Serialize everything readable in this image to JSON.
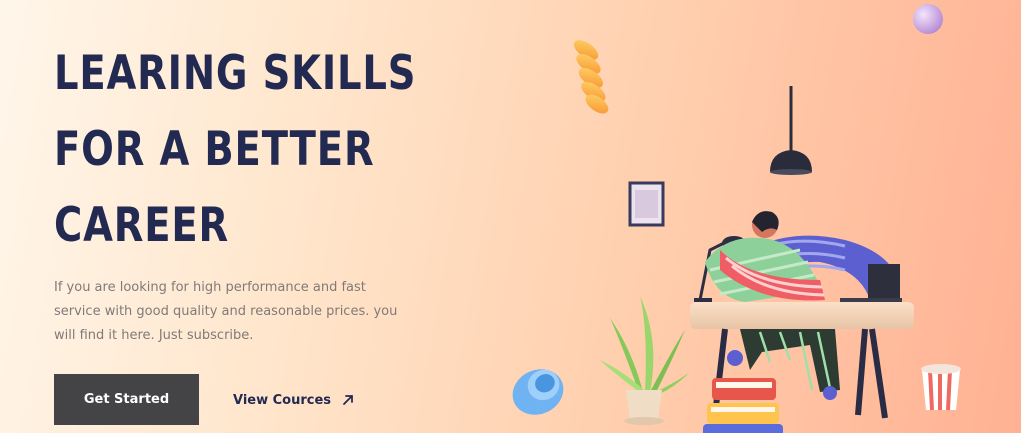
{
  "hero": {
    "title_lines": [
      "LEARING SKILLS",
      "FOR A BETTER",
      "CAREER"
    ],
    "description": "If you are looking for high performance and fast service with good quality and reasonable prices. you will find it here. Just subscribe.",
    "primary_button": "Get Started",
    "secondary_link": "View Cources"
  },
  "colors": {
    "title": "#232a52",
    "button_bg": "#444446",
    "text_muted": "#807a78"
  },
  "icons": {
    "secondary_link": "arrow-up-right-icon"
  }
}
